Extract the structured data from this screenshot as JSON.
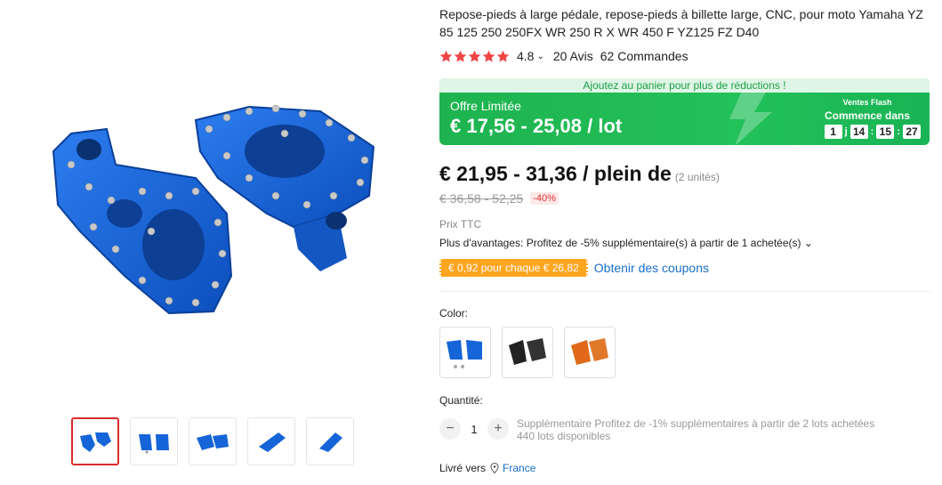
{
  "product": {
    "title": "Repose-pieds à large pédale, repose-pieds à billette large, CNC, pour moto Yamaha YZ 85 125 250 250FX WR 250 R X WR 450 F YZ125 FZ D40",
    "rating": "4.8",
    "rating_chevron": "⌄",
    "reviews": "20 Avis",
    "orders": "62 Commandes",
    "stars": 5
  },
  "deal": {
    "banner": "Ajoutez au panier pour plus de réductions !",
    "label": "Offre Limitée",
    "price": "€ 17,56 - 25,08 / lot",
    "flash_title": "Ventes Flash",
    "flash_sub": "Commence dans",
    "timer": [
      "1",
      "14",
      "15",
      "27"
    ],
    "timer_seps": [
      "j",
      ":",
      ":"
    ]
  },
  "pricing": {
    "price": "€ 21,95 - 31,36 / plein de",
    "units": "(2 unités)",
    "old_price": "€ 36,58 - 52,25",
    "discount": "-40%",
    "tax": "Prix TTC",
    "advantages": "Plus d'avantages: Profitez de -5% supplémentaire(s) à partir de 1 achetée(s) ⌄",
    "coupon_tag": "€ 0,92 pour chaque € 26,82",
    "coupon_link": "Obtenir des coupons"
  },
  "options": {
    "color_label": "Color:",
    "swatches": [
      "blue-set",
      "black",
      "orange"
    ],
    "quantity_label": "Quantité:",
    "minus": "−",
    "quantity": "1",
    "plus": "+",
    "qty_note": "Supplémentaire Profitez de -1% supplémentaires à partir de 2 lots achetées",
    "stock": "440 lots disponibles"
  },
  "shipping": {
    "label": "Livré vers",
    "location": "France"
  },
  "colors": {
    "accent_red": "#d92d2d",
    "deal_green": "#1eb34f",
    "coupon_orange": "#ffa51f",
    "link_blue": "#1a6fc9",
    "star_red": "#f04545",
    "product_blue": "#1565d8",
    "product_orange": "#e06a1a"
  }
}
